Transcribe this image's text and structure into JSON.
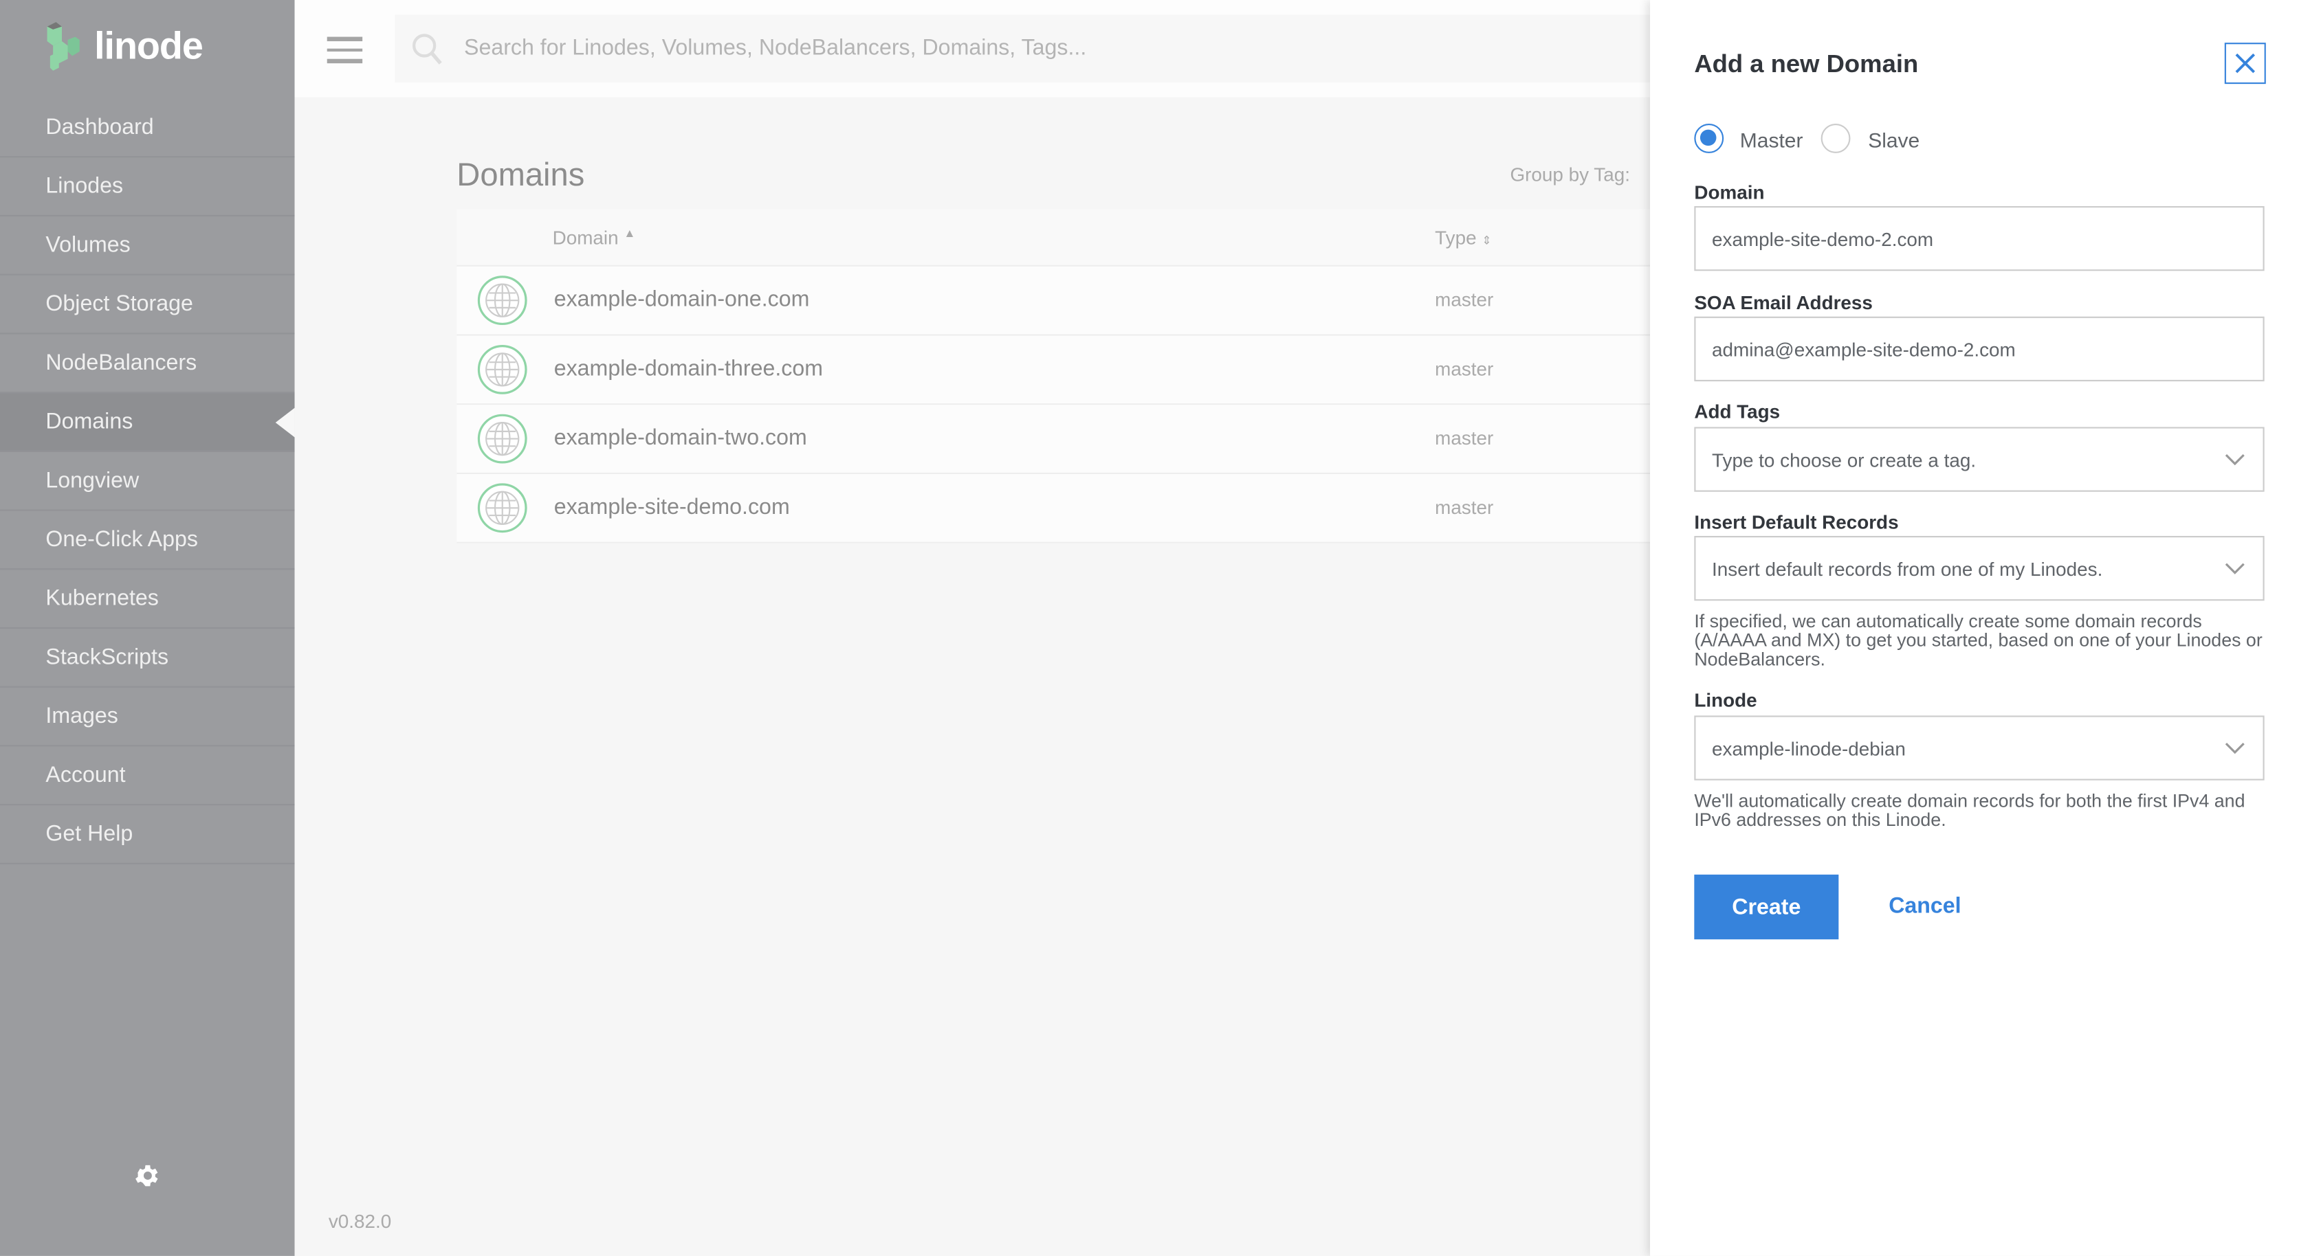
{
  "brand": {
    "name": "linode",
    "logo_color": "#8fd5a6"
  },
  "sidebar": {
    "items": [
      {
        "label": "Dashboard"
      },
      {
        "label": "Linodes"
      },
      {
        "label": "Volumes"
      },
      {
        "label": "Object Storage"
      },
      {
        "label": "NodeBalancers"
      },
      {
        "label": "Domains",
        "active": true
      },
      {
        "label": "Longview"
      },
      {
        "label": "One-Click Apps"
      },
      {
        "label": "Kubernetes"
      },
      {
        "label": "StackScripts"
      },
      {
        "label": "Images"
      },
      {
        "label": "Account"
      },
      {
        "label": "Get Help"
      }
    ],
    "settings_icon": "gear-icon"
  },
  "search": {
    "placeholder": "Search for Linodes, Volumes, NodeBalancers, Domains, Tags..."
  },
  "main": {
    "title": "Domains",
    "group_by_label": "Group by Tag:",
    "columns": [
      "Domain",
      "Type"
    ],
    "rows": [
      {
        "domain": "example-domain-one.com",
        "type": "master"
      },
      {
        "domain": "example-domain-three.com",
        "type": "master"
      },
      {
        "domain": "example-domain-two.com",
        "type": "master"
      },
      {
        "domain": "example-site-demo.com",
        "type": "master"
      }
    ],
    "version": "v0.82.0"
  },
  "panel": {
    "title": "Add a new Domain",
    "radio": {
      "master": "Master",
      "slave": "Slave",
      "selected": "Master"
    },
    "domain_label": "Domain",
    "domain_value": "example-site-demo-2.com",
    "soa_label": "SOA Email Address",
    "soa_value": "admina@example-site-demo-2.com",
    "tags_label": "Add Tags",
    "tags_placeholder": "Type to choose or create a tag.",
    "records_label": "Insert Default Records",
    "records_value": "Insert default records from one of my Linodes.",
    "records_help": "If specified, we can automatically create some domain records (A/AAAA and MX) to get you started, based on one of your Linodes or NodeBalancers.",
    "linode_label": "Linode",
    "linode_value": "example-linode-debian",
    "linode_help": "We'll automatically create domain records for both the first IPv4 and IPv6 addresses on this Linode.",
    "create": "Create",
    "cancel": "Cancel",
    "accent": "#3683dc"
  }
}
